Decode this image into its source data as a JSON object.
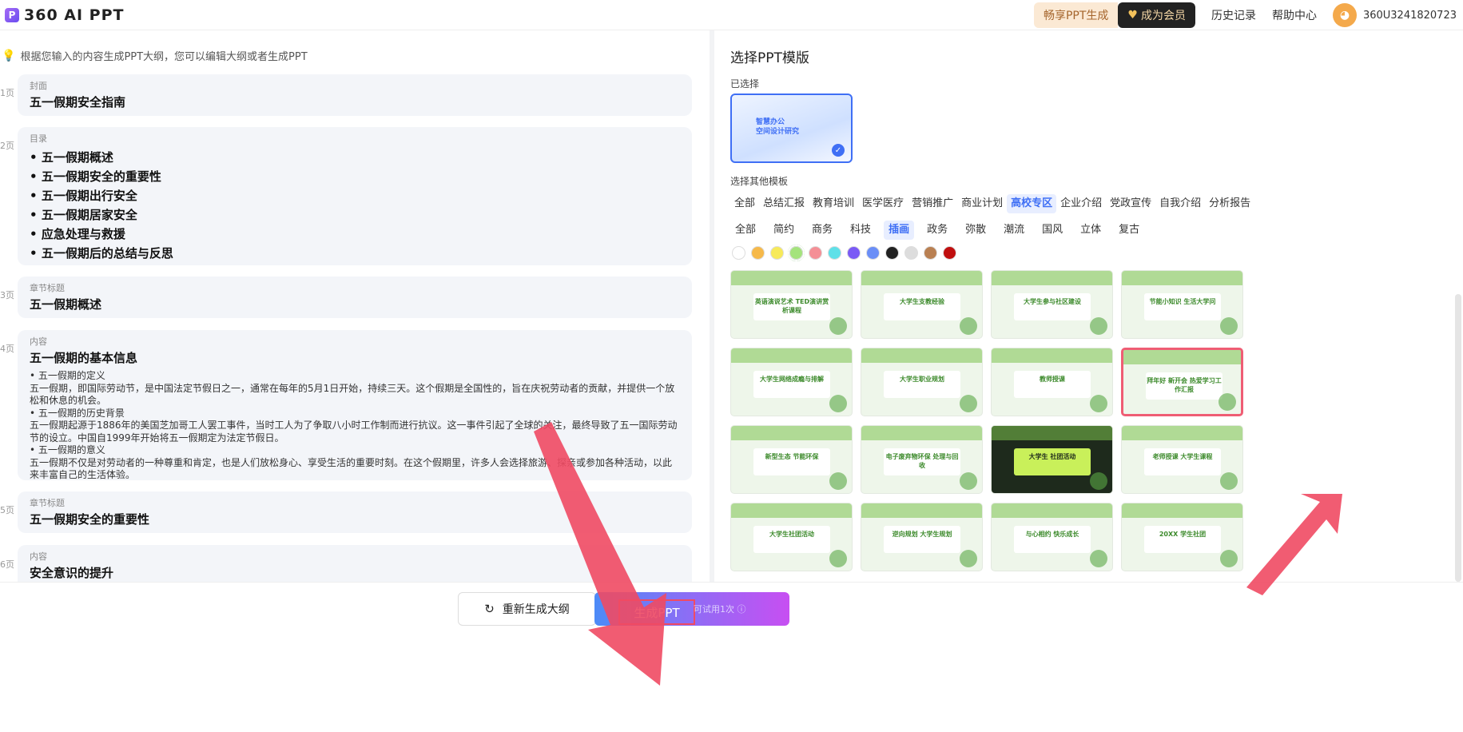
{
  "app": {
    "logo_mark": "P",
    "title": "360 AI PPT"
  },
  "topbar": {
    "promo_left": "畅享PPT生成",
    "promo_right": "成为会员",
    "history": "历史记录",
    "help": "帮助中心",
    "username": "360U3241820723"
  },
  "outline": {
    "hint": "根据您输入的内容生成PPT大纲，您可以编辑大纲或者生成PPT",
    "pages": [
      {
        "no": "1页",
        "type": "封面",
        "title": "五一假期安全指南"
      },
      {
        "no": "2页",
        "type": "目录",
        "items": [
          "五一假期概述",
          "五一假期安全的重要性",
          "五一假期出行安全",
          "五一假期居家安全",
          "应急处理与救援",
          "五一假期后的总结与反思"
        ]
      },
      {
        "no": "3页",
        "type": "章节标题",
        "title": "五一假期概述"
      },
      {
        "no": "4页",
        "type": "内容",
        "title": "五一假期的基本信息",
        "lines": [
          "• 五一假期的定义",
          "五一假期，即国际劳动节，是中国法定节假日之一，通常在每年的5月1日开始，持续三天。这个假期是全国性的，旨在庆祝劳动者的贡献，并提供一个放松和休息的机会。",
          "• 五一假期的历史背景",
          "五一假期起源于1886年的美国芝加哥工人罢工事件，当时工人为了争取八小时工作制而进行抗议。这一事件引起了全球的关注，最终导致了五一国际劳动节的设立。中国自1999年开始将五一假期定为法定节假日。",
          "• 五一假期的意义",
          "五一假期不仅是对劳动者的一种尊重和肯定，也是人们放松身心、享受生活的重要时刻。在这个假期里，许多人会选择旅游、探亲或参加各种活动，以此来丰富自己的生活体验。"
        ]
      },
      {
        "no": "5页",
        "type": "章节标题",
        "title": "五一假期安全的重要性"
      },
      {
        "no": "6页",
        "type": "内容",
        "title": "安全意识的提升"
      }
    ]
  },
  "footer": {
    "regen_label": "重新生成大纲",
    "generate_label": "生成PPT",
    "generate_sub": "可试用1次 ⓘ"
  },
  "templates": {
    "title": "选择PPT模版",
    "selected_label": "已选择",
    "selected_text": "智慧办公\n空间设计研究",
    "other_label": "选择其他模板",
    "categories": [
      "全部",
      "总结汇报",
      "教育培训",
      "医学医疗",
      "营销推广",
      "商业计划",
      "高校专区",
      "企业介绍",
      "党政宣传",
      "自我介绍",
      "分析报告"
    ],
    "active_category": "高校专区",
    "styles": [
      "全部",
      "简约",
      "商务",
      "科技",
      "插画",
      "政务",
      "弥散",
      "潮流",
      "国风",
      "立体",
      "复古"
    ],
    "active_style": "插画",
    "colors": [
      "#ffffff",
      "#f6b94a",
      "#f7ea5a",
      "#a4e37c",
      "#f48f96",
      "#5fe0e8",
      "#7a5af5",
      "#6a8ef7",
      "#222222",
      "#dddddd",
      "#b98052",
      "#c00f0f"
    ],
    "thumbs": [
      "英语演说艺术 TED演讲赏析课程",
      "大学生支教经验",
      "大学生参与社区建设",
      "节能小知识 生活大学问",
      "大学生网络成瘾与排解",
      "大学生职业规划",
      "教师授课",
      "拜年好 新开会 热爱学习工作汇报",
      "新型生态 节能环保",
      "电子废弃物环保 处理与回收",
      "大学生 社团活动",
      "老师授课 大学生课程",
      "大学生社团活动",
      "逆向规划 大学生规划",
      "与心相约 快乐成长",
      "20XX 学生社团"
    ]
  }
}
